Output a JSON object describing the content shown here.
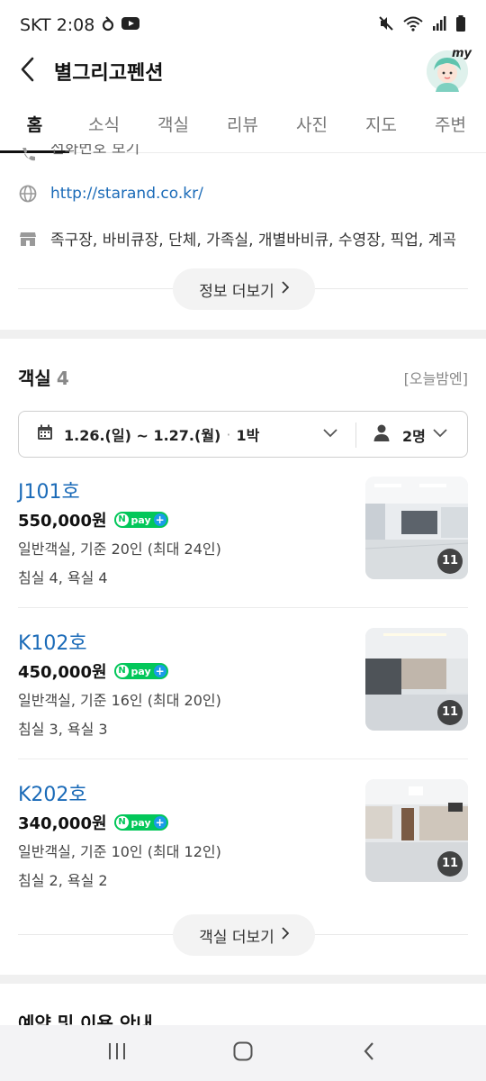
{
  "status_bar": {
    "carrier_time": "SKT 2:08"
  },
  "header": {
    "title": "별그리고펜션",
    "avatar_text": "my"
  },
  "tabs": [
    "홈",
    "소식",
    "객실",
    "리뷰",
    "사진",
    "지도",
    "주변"
  ],
  "info": {
    "partial_text": "전화번호 보기",
    "website": "http://starand.co.kr/",
    "facilities": "족구장, 바비큐장, 단체, 가족실, 개별바비큐, 수영장, 픽업, 계곡",
    "more_label": "정보 더보기"
  },
  "rooms_section": {
    "title": "객실",
    "count": "4",
    "aside": "[오늘밤엔]",
    "date_range": "1.26.(일) ~ 1.27.(월)",
    "date_sep": "·",
    "nights": "1박",
    "guests": "2명",
    "more_label": "객실 더보기"
  },
  "rooms": [
    {
      "name": "J101호",
      "price": "550,000원",
      "desc": "일반객실, 기준 20인 (최대 24인)",
      "beds": "침실 4, 욕실 4",
      "photo_count": "11"
    },
    {
      "name": "K102호",
      "price": "450,000원",
      "desc": "일반객실, 기준 16인 (최대 20인)",
      "beds": "침실 3, 욕실 3",
      "photo_count": "11"
    },
    {
      "name": "K202호",
      "price": "340,000원",
      "desc": "일반객실, 기준 10인 (최대 12인)",
      "beds": "침실 2, 욕실 2",
      "photo_count": "11"
    }
  ],
  "npay": {
    "n": "N",
    "label": "pay",
    "plus": "+"
  },
  "next_section_title": "예약 및 이용 안내",
  "colors": {
    "link": "#1b6bb8",
    "npay_green": "#03c75a"
  }
}
